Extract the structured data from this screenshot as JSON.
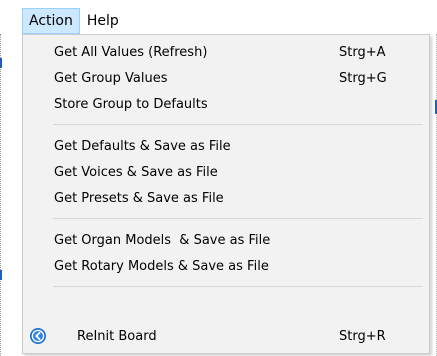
{
  "menubar": {
    "items": [
      {
        "label": "Action"
      },
      {
        "label": "Help"
      }
    ]
  },
  "menu": {
    "groups": [
      [
        {
          "label": "Get All Values (Refresh)",
          "shortcut": "Strg+A"
        },
        {
          "label": "Get Group Values",
          "shortcut": "Strg+G"
        },
        {
          "label": "Store Group to Defaults",
          "shortcut": ""
        }
      ],
      [
        {
          "label": "Get Defaults & Save as File",
          "shortcut": ""
        },
        {
          "label": "Get Voices & Save as File",
          "shortcut": ""
        },
        {
          "label": "Get Presets & Save as File",
          "shortcut": ""
        }
      ],
      [
        {
          "label": "Get Organ Models  & Save as File",
          "shortcut": ""
        },
        {
          "label": "Get Rotary Models & Save as File",
          "shortcut": ""
        }
      ],
      [
        {
          "label": "ReInit Board",
          "shortcut": "Strg+R",
          "icon": "reinit-icon"
        }
      ]
    ]
  },
  "colors": {
    "menubar_active_bg": "#cce8ff",
    "menubar_active_border": "#99d1ff",
    "menu_bg": "#f2f2f2",
    "separator": "#d7d7d7",
    "icon_blue": "#1f6fd1"
  }
}
